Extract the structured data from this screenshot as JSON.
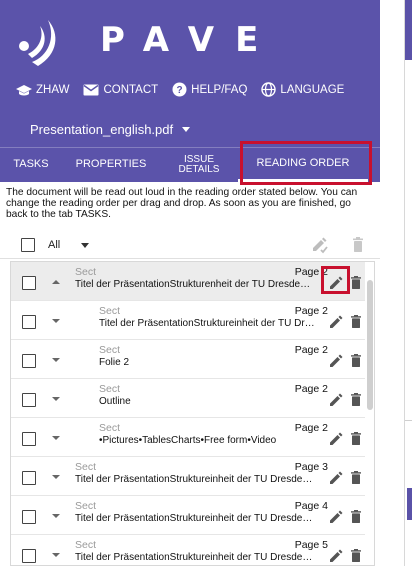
{
  "app": {
    "name": "PAVE"
  },
  "nav": [
    {
      "label": "ZHAW",
      "icon": "graduation-cap-icon"
    },
    {
      "label": "CONTACT",
      "icon": "mail-icon"
    },
    {
      "label": "HELP/FAQ",
      "icon": "help-circle-icon"
    },
    {
      "label": "LANGUAGE",
      "icon": "globe-icon"
    }
  ],
  "document": {
    "filename": "Presentation_english.pdf"
  },
  "tabs": [
    {
      "label": "TASKS",
      "active": false
    },
    {
      "label": "PROPERTIES",
      "active": false
    },
    {
      "label_line1": "ISSUE",
      "label_line2": "DETAILS",
      "active": false
    },
    {
      "label": "READING ORDER",
      "active": true
    }
  ],
  "info_text": "The document will be read out loud in the reading order stated below. You can change the reading order per drag and drop. As soon as you are finished, go back to the tab TASKS.",
  "toolbar": {
    "select_all_label": "All"
  },
  "items": [
    {
      "type": "Sect",
      "title": "Titel der PräsentationStrukturenheit der TU Dresde…",
      "page": "Page 2",
      "level": 1,
      "expanded": true,
      "selected": true
    },
    {
      "type": "Sect",
      "title": "Titel der PräsentationStruktureinheit der TU Dr…",
      "page": "Page 2",
      "level": 2,
      "expanded": false,
      "selected": false
    },
    {
      "type": "Sect",
      "title": "Folie 2",
      "page": "Page 2",
      "level": 2,
      "expanded": false,
      "selected": false
    },
    {
      "type": "Sect",
      "title": "Outline",
      "page": "Page 2",
      "level": 2,
      "expanded": false,
      "selected": false
    },
    {
      "type": "Sect",
      "title": "•Pictures•TablesCharts•Free form•Video",
      "page": "Page 2",
      "level": 2,
      "expanded": false,
      "selected": false
    },
    {
      "type": "Sect",
      "title": "Titel der PräsentationStruktureinheit der TU Dresde…",
      "page": "Page 3",
      "level": 1,
      "expanded": false,
      "selected": false
    },
    {
      "type": "Sect",
      "title": "Titel der PräsentationStruktureinheit der TU Dresde…",
      "page": "Page 4",
      "level": 1,
      "expanded": false,
      "selected": false
    },
    {
      "type": "Sect",
      "title": "Titel der PräsentationStruktureinheit der TU Dresde…",
      "page": "Page 5",
      "level": 1,
      "expanded": false,
      "selected": false
    }
  ],
  "colors": {
    "brand": "#5b53aa",
    "highlight": "#c8102e"
  }
}
